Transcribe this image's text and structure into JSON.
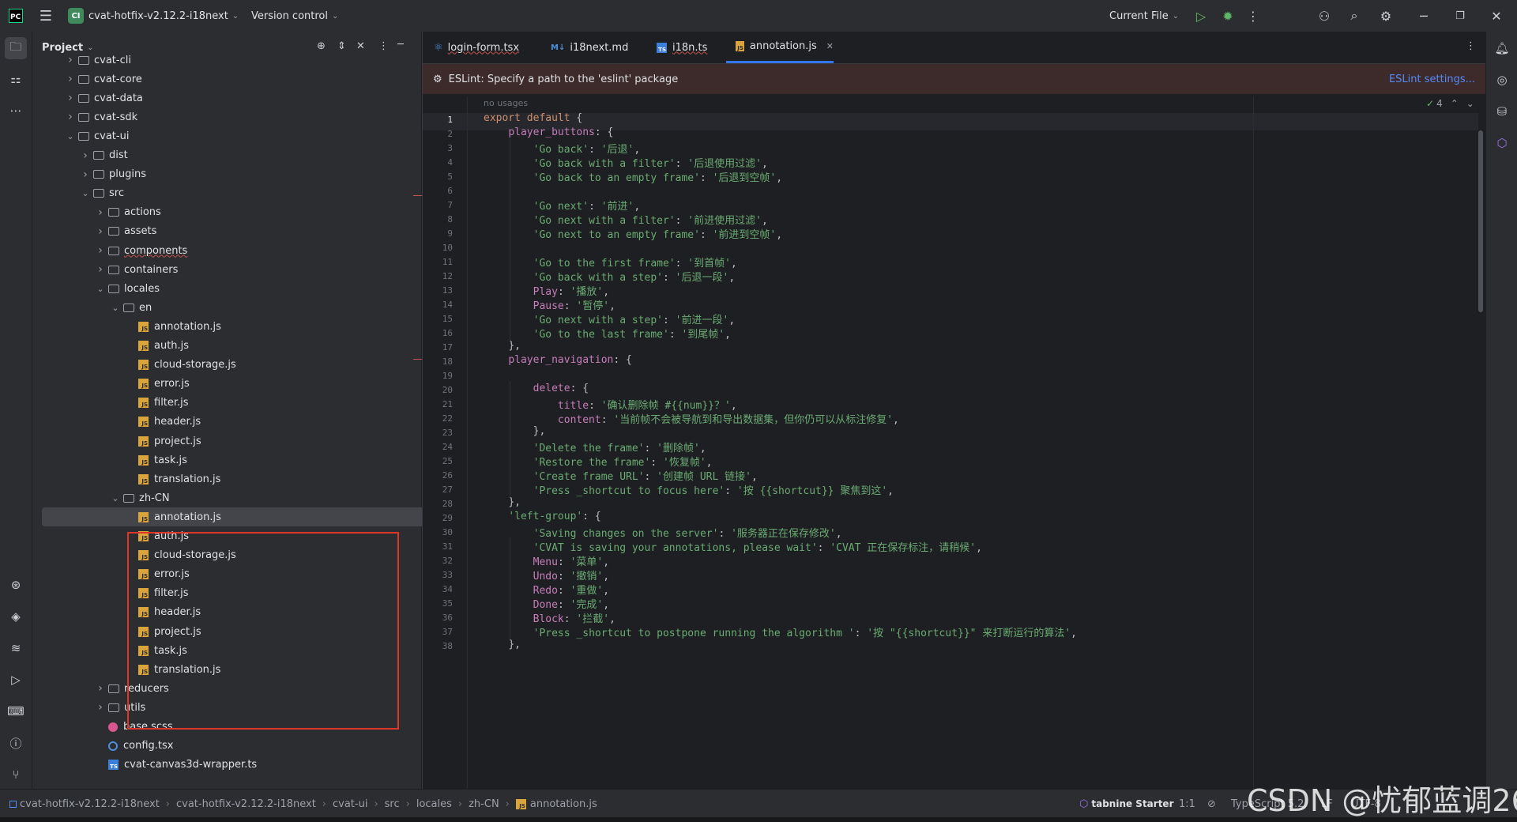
{
  "titlebar": {
    "project_badge": "CI",
    "project_name": "cvat-hotfix-v2.12.2-i18next",
    "vcs_label": "Version control",
    "run_config": "Current File"
  },
  "project_panel": {
    "title": "Project",
    "tree": [
      {
        "label": "cvat-cli",
        "type": "folder",
        "depth": 0,
        "expanded": false
      },
      {
        "label": "cvat-core",
        "type": "folder",
        "depth": 0,
        "expanded": false
      },
      {
        "label": "cvat-data",
        "type": "folder",
        "depth": 0,
        "expanded": false
      },
      {
        "label": "cvat-sdk",
        "type": "folder",
        "depth": 0,
        "expanded": false
      },
      {
        "label": "cvat-ui",
        "type": "folder",
        "depth": 0,
        "expanded": true
      },
      {
        "label": "dist",
        "type": "folder",
        "depth": 1,
        "expanded": false
      },
      {
        "label": "plugins",
        "type": "folder",
        "depth": 1,
        "expanded": false
      },
      {
        "label": "src",
        "type": "folder",
        "depth": 1,
        "expanded": true
      },
      {
        "label": "actions",
        "type": "folder",
        "depth": 2,
        "expanded": false
      },
      {
        "label": "assets",
        "type": "folder",
        "depth": 2,
        "expanded": false
      },
      {
        "label": "components",
        "type": "folder",
        "depth": 2,
        "expanded": false,
        "error": true
      },
      {
        "label": "containers",
        "type": "folder",
        "depth": 2,
        "expanded": false
      },
      {
        "label": "locales",
        "type": "folder",
        "depth": 2,
        "expanded": true
      },
      {
        "label": "en",
        "type": "folder",
        "depth": 3,
        "expanded": true
      },
      {
        "label": "annotation.js",
        "type": "js",
        "depth": 4
      },
      {
        "label": "auth.js",
        "type": "js",
        "depth": 4
      },
      {
        "label": "cloud-storage.js",
        "type": "js",
        "depth": 4
      },
      {
        "label": "error.js",
        "type": "js",
        "depth": 4
      },
      {
        "label": "filter.js",
        "type": "js",
        "depth": 4
      },
      {
        "label": "header.js",
        "type": "js",
        "depth": 4
      },
      {
        "label": "project.js",
        "type": "js",
        "depth": 4
      },
      {
        "label": "task.js",
        "type": "js",
        "depth": 4
      },
      {
        "label": "translation.js",
        "type": "js",
        "depth": 4
      },
      {
        "label": "zh-CN",
        "type": "folder",
        "depth": 3,
        "expanded": true
      },
      {
        "label": "annotation.js",
        "type": "js",
        "depth": 4,
        "selected": true
      },
      {
        "label": "auth.js",
        "type": "js",
        "depth": 4
      },
      {
        "label": "cloud-storage.js",
        "type": "js",
        "depth": 4
      },
      {
        "label": "error.js",
        "type": "js",
        "depth": 4
      },
      {
        "label": "filter.js",
        "type": "js",
        "depth": 4
      },
      {
        "label": "header.js",
        "type": "js",
        "depth": 4
      },
      {
        "label": "project.js",
        "type": "js",
        "depth": 4
      },
      {
        "label": "task.js",
        "type": "js",
        "depth": 4
      },
      {
        "label": "translation.js",
        "type": "js",
        "depth": 4
      },
      {
        "label": "reducers",
        "type": "folder",
        "depth": 2,
        "expanded": false
      },
      {
        "label": "utils",
        "type": "folder",
        "depth": 2,
        "expanded": false
      },
      {
        "label": "base.scss",
        "type": "scss",
        "depth": 2
      },
      {
        "label": "config.tsx",
        "type": "cfg",
        "depth": 2
      },
      {
        "label": "cvat-canvas3d-wrapper.ts",
        "type": "ts",
        "depth": 2
      }
    ]
  },
  "tabs": [
    {
      "label": "login-form.tsx",
      "icon": "react-icon",
      "badge": ""
    },
    {
      "label": "i18next.md",
      "icon": "markdown-icon",
      "badge": "M↓"
    },
    {
      "label": "i18n.ts",
      "icon": "ts-file-icon",
      "badge": "TS"
    },
    {
      "label": "annotation.js",
      "icon": "js-file-icon",
      "badge": "JS",
      "active": true
    }
  ],
  "eslint": {
    "message": "ESLint: Specify a path to the 'eslint' package",
    "action": "ESLint settings..."
  },
  "editor": {
    "usages_hint": "no usages",
    "inspection_count": "4",
    "lines": [
      "export default {",
      "    player_buttons: {",
      "        'Go back': '后退',",
      "        'Go back with a filter': '后退使用过滤',",
      "        'Go back to an empty frame': '后退到空帧',",
      "",
      "        'Go next': '前进',",
      "        'Go next with a filter': '前进使用过滤',",
      "        'Go next to an empty frame': '前进到空帧',",
      "",
      "        'Go to the first frame': '到首帧',",
      "        'Go back with a step': '后退一段',",
      "        Play: '播放',",
      "        Pause: '暂停',",
      "        'Go next with a step': '前进一段',",
      "        'Go to the last frame': '到尾帧',",
      "    },",
      "    player_navigation: {",
      "",
      "        delete: {",
      "            title: '确认删除帧 #{{num}}？',",
      "            content: '当前帧不会被导航到和导出数据集，但你仍可以从标注修复',",
      "        },",
      "        'Delete the frame': '删除帧',",
      "        'Restore the frame': '恢复帧',",
      "        'Create frame URL': '创建帧 URL 链接',",
      "        'Press _shortcut to focus here': '按 {{shortcut}} 聚焦到这',",
      "    },",
      "    'left-group': {",
      "        'Saving changes on the server': '服务器正在保存修改',",
      "        'CVAT is saving your annotations, please wait': 'CVAT 正在保存标注，请稍候',",
      "        Menu: '菜单',",
      "        Undo: '撤销',",
      "        Redo: '重做',",
      "        Done: '完成',",
      "        Block: '拦截',",
      "        'Press _shortcut to postpone running the algorithm ': '按 \"{{shortcut}}\" 来打断运行的算法',",
      "    },"
    ]
  },
  "statusbar": {
    "breadcrumbs": [
      "cvat-hotfix-v2.12.2-i18next",
      "cvat-hotfix-v2.12.2-i18next",
      "cvat-ui",
      "src",
      "locales",
      "zh-CN",
      "annotation.js"
    ],
    "tabnine": "tabnine Starter",
    "position": "1:1",
    "filetype": "TypeScript 5.2",
    "line_ending": "LF",
    "encoding": "UTF-8"
  },
  "watermark": "CSDN @忧郁蓝调26",
  "colors": {
    "accent": "#3574f0",
    "highlight_box": "#e0352b",
    "keyword": "#cf8e6d",
    "property": "#c77dbb",
    "string": "#6aab73"
  }
}
